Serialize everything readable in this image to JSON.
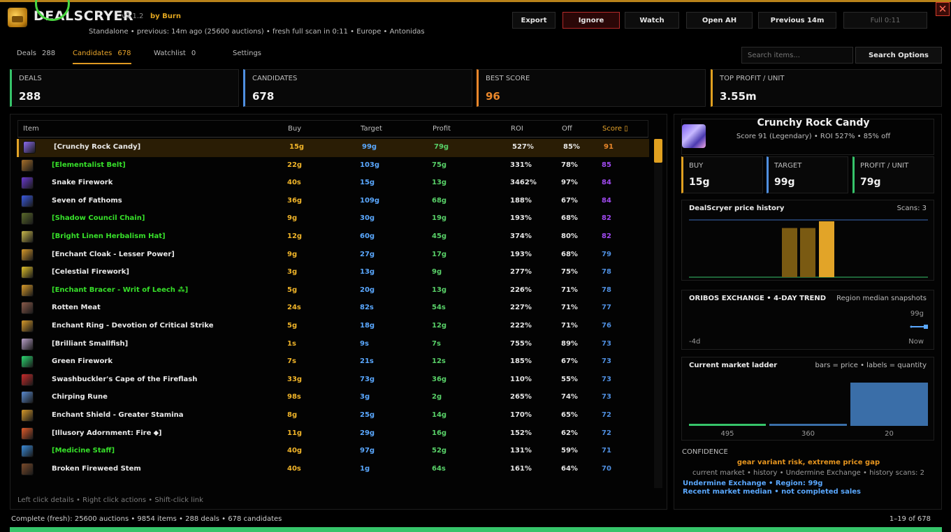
{
  "app": {
    "title": "DEALSCRYER",
    "version": "v3.1.2",
    "author": "by Burn",
    "subtitle": "Standalone • previous: 14m ago (25600 auctions) • fresh full scan in 0:11 • Europe • Antonidas"
  },
  "header_buttons": [
    "Export",
    "Ignore",
    "Watch",
    "Open AH",
    "Previous 14m",
    "Full 0:11"
  ],
  "close_glyph": "✕",
  "tabs": [
    {
      "label": "Deals",
      "count": "288"
    },
    {
      "label": "Candidates",
      "count": "678"
    },
    {
      "label": "Watchlist",
      "count": "0"
    },
    {
      "label": "Settings",
      "count": ""
    }
  ],
  "search": {
    "placeholder": "Search items...",
    "options_label": "Search Options"
  },
  "stats": [
    {
      "label": "DEALS",
      "value": "288",
      "color": "#36c46a"
    },
    {
      "label": "CANDIDATES",
      "value": "678",
      "color": "#4f8fe0"
    },
    {
      "label": "BEST SCORE",
      "value": "96",
      "color": "#e8862a"
    },
    {
      "label": "TOP PROFIT / UNIT",
      "value": "3.55m",
      "color": "#e0a020"
    }
  ],
  "table": {
    "columns": [
      "Item",
      "Buy",
      "Target",
      "Profit",
      "ROI",
      "Off",
      "Score"
    ],
    "sort_indicator": "▯",
    "rows": [
      {
        "name": "[Crunchy Rock Candy]",
        "quality": "white",
        "buy": "15g",
        "target": "99g",
        "profit": "79g",
        "roi": "527%",
        "off": "85%",
        "score": "91",
        "score_color": "#e8862a",
        "icon": "#8c6cf0"
      },
      {
        "name": "[Elementalist Belt]",
        "quality": "green",
        "buy": "22g",
        "target": "103g",
        "profit": "75g",
        "roi": "331%",
        "off": "78%",
        "score": "85",
        "score_color": "#a04af0",
        "icon": "#a8702a"
      },
      {
        "name": "Snake Firework",
        "quality": "white",
        "buy": "40s",
        "target": "15g",
        "profit": "13g",
        "roi": "3462%",
        "off": "97%",
        "score": "84",
        "score_color": "#a04af0",
        "icon": "#6a3ad0"
      },
      {
        "name": "Seven of Fathoms",
        "quality": "white",
        "buy": "36g",
        "target": "109g",
        "profit": "68g",
        "roi": "188%",
        "off": "67%",
        "score": "84",
        "score_color": "#a04af0",
        "icon": "#3a5ae0"
      },
      {
        "name": "[Shadow Council Chain]",
        "quality": "green",
        "buy": "9g",
        "target": "30g",
        "profit": "19g",
        "roi": "193%",
        "off": "68%",
        "score": "82",
        "score_color": "#a04af0",
        "icon": "#5a6a2a"
      },
      {
        "name": "[Bright Linen Herbalism Hat]",
        "quality": "green",
        "buy": "12g",
        "target": "60g",
        "profit": "45g",
        "roi": "374%",
        "off": "80%",
        "score": "82",
        "score_color": "#a04af0",
        "icon": "#c8b84a"
      },
      {
        "name": "[Enchant Cloak - Lesser Power]",
        "quality": "white",
        "buy": "9g",
        "target": "27g",
        "profit": "17g",
        "roi": "193%",
        "off": "68%",
        "score": "79",
        "score_color": "#4f8fe0",
        "icon": "#d89a2a"
      },
      {
        "name": "[Celestial Firework]",
        "quality": "white",
        "buy": "3g",
        "target": "13g",
        "profit": "9g",
        "roi": "277%",
        "off": "75%",
        "score": "78",
        "score_color": "#4f8fe0",
        "icon": "#e0c02a"
      },
      {
        "name": "[Enchant Bracer - Writ of Leech ⁂]",
        "quality": "green",
        "buy": "5g",
        "target": "20g",
        "profit": "13g",
        "roi": "226%",
        "off": "71%",
        "score": "78",
        "score_color": "#4f8fe0",
        "icon": "#d89a2a"
      },
      {
        "name": "Rotten Meat",
        "quality": "white",
        "buy": "24s",
        "target": "82s",
        "profit": "54s",
        "roi": "227%",
        "off": "71%",
        "score": "77",
        "score_color": "#4f8fe0",
        "icon": "#8a5a4a"
      },
      {
        "name": "Enchant Ring - Devotion of Critical Strike",
        "quality": "white",
        "buy": "5g",
        "target": "18g",
        "profit": "12g",
        "roi": "222%",
        "off": "71%",
        "score": "76",
        "score_color": "#4f8fe0",
        "icon": "#d89a2a"
      },
      {
        "name": "[Brilliant Smallfish]",
        "quality": "white",
        "buy": "1s",
        "target": "9s",
        "profit": "7s",
        "roi": "755%",
        "off": "89%",
        "score": "73",
        "score_color": "#4f8fe0",
        "icon": "#b8a0c8"
      },
      {
        "name": "Green Firework",
        "quality": "white",
        "buy": "7s",
        "target": "21s",
        "profit": "12s",
        "roi": "185%",
        "off": "67%",
        "score": "73",
        "score_color": "#4f8fe0",
        "icon": "#2ad870"
      },
      {
        "name": "Swashbuckler's Cape of the Fireflash",
        "quality": "white",
        "buy": "33g",
        "target": "73g",
        "profit": "36g",
        "roi": "110%",
        "off": "55%",
        "score": "73",
        "score_color": "#4f8fe0",
        "icon": "#c82a2a"
      },
      {
        "name": "Chirping Rune",
        "quality": "white",
        "buy": "98s",
        "target": "3g",
        "profit": "2g",
        "roi": "265%",
        "off": "74%",
        "score": "73",
        "score_color": "#4f8fe0",
        "icon": "#5a8ad0"
      },
      {
        "name": "Enchant Shield - Greater Stamina",
        "quality": "white",
        "buy": "8g",
        "target": "25g",
        "profit": "14g",
        "roi": "170%",
        "off": "65%",
        "score": "72",
        "score_color": "#4f8fe0",
        "icon": "#d89a2a"
      },
      {
        "name": "[Illusory Adornment: Fire ⬥]",
        "quality": "white",
        "buy": "11g",
        "target": "29g",
        "profit": "16g",
        "roi": "152%",
        "off": "62%",
        "score": "72",
        "score_color": "#4f8fe0",
        "icon": "#e05a2a"
      },
      {
        "name": "[Medicine Staff]",
        "quality": "green",
        "buy": "40g",
        "target": "97g",
        "profit": "52g",
        "roi": "131%",
        "off": "59%",
        "score": "71",
        "score_color": "#4f8fe0",
        "icon": "#3a8ad8"
      },
      {
        "name": "Broken Fireweed Stem",
        "quality": "white",
        "buy": "40s",
        "target": "1g",
        "profit": "64s",
        "roi": "161%",
        "off": "64%",
        "score": "70",
        "score_color": "#4f8fe0",
        "icon": "#7a4a2a"
      }
    ]
  },
  "help_text": "Left click details  •  Right click actions  •  Shift-click link",
  "detail": {
    "name": "Crunchy Rock Candy",
    "sub": "Score 91 (Legendary)  •  ROI 527%  •  85% off",
    "stats": [
      {
        "label": "BUY",
        "value": "15g",
        "color": "#e0a020"
      },
      {
        "label": "TARGET",
        "value": "99g",
        "color": "#4f8fe0"
      },
      {
        "label": "PROFIT / UNIT",
        "value": "79g",
        "color": "#36c46a"
      }
    ],
    "history": {
      "title": "DealScryer price history",
      "right": "Scans: 3",
      "bars": [
        0.88,
        0.88,
        1.0
      ]
    },
    "trend": {
      "title": "ORIBOS EXCHANGE • 4-DAY TREND",
      "right": "Region median snapshots",
      "top_label": "99g",
      "x_start": "-4d",
      "x_end": "Now"
    },
    "ladder": {
      "title": "Current market ladder",
      "right": "bars = price • labels = quantity",
      "quantities": [
        "495",
        "360",
        "20"
      ],
      "price_ratio": [
        0.04,
        0.04,
        1.0
      ]
    },
    "confidence": {
      "title": "CONFIDENCE",
      "warning": "gear variant risk, extreme price gap",
      "meta": "current market • history • Undermine Exchange  •  history scans: 2",
      "link1": "Undermine Exchange • Region: 99g",
      "link2": "Recent market median • not completed sales"
    }
  },
  "footer": {
    "status": "Complete (fresh): 25600 auctions • 9854 items • 288 deals • 678 candidates",
    "pager": "1–19 of 678",
    "progress": 1.0
  }
}
